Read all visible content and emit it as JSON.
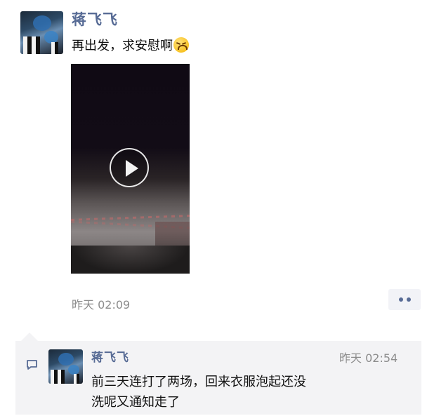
{
  "post": {
    "author": "蒋飞飞",
    "text": "再出发，求安慰啊",
    "text_emoji": "grimace-emoji",
    "video": {
      "play_icon": "play-icon"
    },
    "time": "昨天 02:09",
    "more_icon": "more-dots-icon"
  },
  "comment": {
    "icon": "comment-icon",
    "author": "蒋飞飞",
    "time": "昨天 02:54",
    "text_lines": [
      "前三天连打了两场，回来衣服泡起还没",
      "洗呢又通知走了"
    ]
  },
  "colors": {
    "name_link": "#576b95",
    "time_gray": "#8c8c8c",
    "comment_bg": "#f3f3f5"
  }
}
